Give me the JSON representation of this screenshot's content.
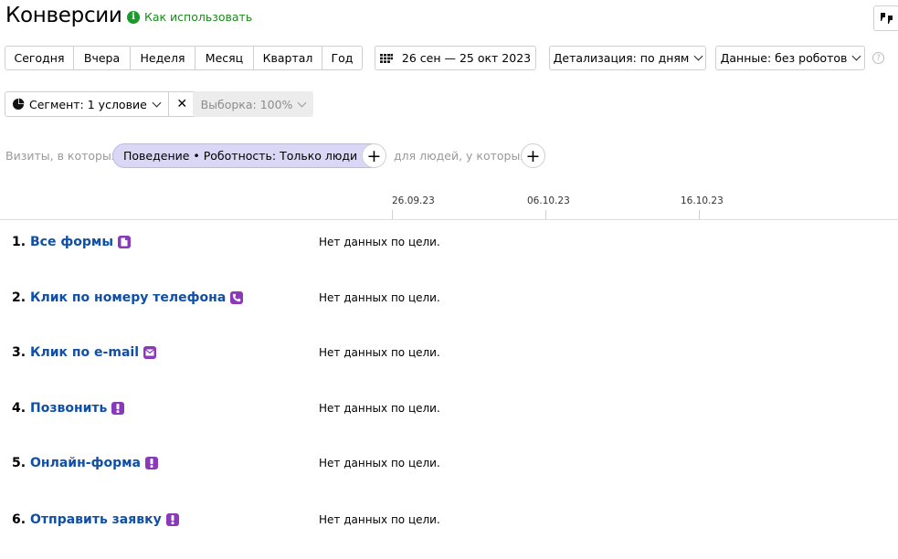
{
  "header": {
    "title": "Конверсии",
    "how_to_use": "Как использовать",
    "info_glyph": "i"
  },
  "period": {
    "buttons": [
      "Сегодня",
      "Вчера",
      "Неделя",
      "Месяц",
      "Квартал",
      "Год"
    ],
    "date_range": "26 сен — 25 окт 2023",
    "detail": "Детализация: по дням",
    "data_filter": "Данные: без роботов",
    "help_glyph": "?"
  },
  "segment": {
    "label": "Сегмент: 1 условие",
    "close_glyph": "✕",
    "sample": "Выборка: 100%"
  },
  "filters": {
    "visits_label": "Визиты, в которых",
    "chip_text": "Поведение • Роботность: Только люди",
    "chip_close": "✕",
    "plus_glyph": "+",
    "people_label": "для людей, у которых"
  },
  "axis": {
    "ticks": [
      "26.09.23",
      "06.10.23",
      "16.10.23"
    ]
  },
  "goals": [
    {
      "num": "1.",
      "name": "Все формы",
      "icon": "form-icon",
      "status": "Нет данных по цели."
    },
    {
      "num": "2.",
      "name": "Клик по номеру телефона",
      "icon": "phone-icon",
      "status": "Нет данных по цели."
    },
    {
      "num": "3.",
      "name": "Клик по e-mail",
      "icon": "email-icon",
      "status": "Нет данных по цели."
    },
    {
      "num": "4.",
      "name": "Позвонить",
      "icon": "exclamation-icon",
      "status": "Нет данных по цели."
    },
    {
      "num": "5.",
      "name": "Онлайн-форма",
      "icon": "exclamation-icon",
      "status": "Нет данных по цели."
    },
    {
      "num": "6.",
      "name": "Отправить заявку",
      "icon": "exclamation-icon",
      "status": "Нет данных по цели."
    }
  ],
  "colors": {
    "link": "#0f4fa8",
    "goal_icon": "#8a3ab9",
    "how_to": "#1a8c1a",
    "chip_bg": "#dad7f6"
  }
}
